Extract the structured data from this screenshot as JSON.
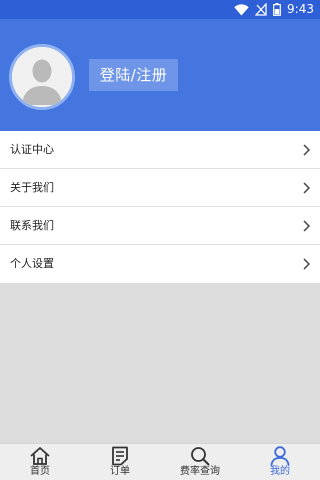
{
  "status_bar": {
    "time": "9:43",
    "icons": [
      "wifi-icon",
      "no-signal-icon",
      "battery-icon"
    ],
    "color": "#2f5fd6"
  },
  "header": {
    "background": "#4576e0",
    "avatar_icon": "default-avatar-icon",
    "login_label": "登陆/注册"
  },
  "menu": {
    "items": [
      {
        "label": "认证中心",
        "icon": "chevron-right-icon"
      },
      {
        "label": "关于我们",
        "icon": "chevron-right-icon"
      },
      {
        "label": "联系我们",
        "icon": "chevron-right-icon"
      },
      {
        "label": "个人设置",
        "icon": "chevron-right-icon"
      }
    ]
  },
  "tabbar": {
    "active_color": "#3a6ad8",
    "tabs": [
      {
        "label": "首页",
        "icon": "home-icon",
        "active": false
      },
      {
        "label": "订单",
        "icon": "order-icon",
        "active": false
      },
      {
        "label": "费率查询",
        "icon": "search-icon",
        "active": false
      },
      {
        "label": "我的",
        "icon": "profile-icon",
        "active": true
      }
    ]
  }
}
